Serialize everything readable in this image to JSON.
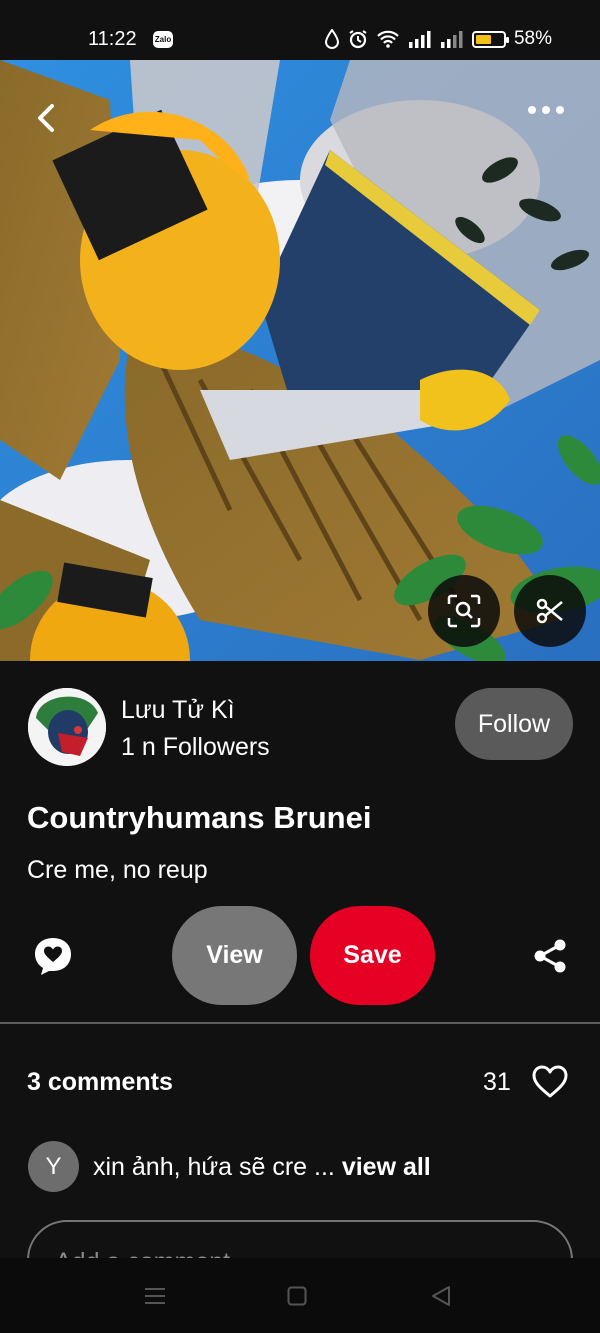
{
  "status_bar": {
    "time": "11:22",
    "notification_app": "Zalo",
    "battery_percent": "58%",
    "battery_level": 0.58,
    "icons": [
      "water-drop-icon",
      "alarm-icon",
      "wifi-icon",
      "signal-icon",
      "signal-icon",
      "battery-icon"
    ]
  },
  "hero": {
    "description_icons": [
      "back-icon",
      "more-icon",
      "visual-search-icon",
      "scissors-icon"
    ]
  },
  "author": {
    "name": "Lưu Tử Kì",
    "followers": "1 n Followers",
    "follow_label": "Follow"
  },
  "pin": {
    "title": "Countryhumans Brunei",
    "description": "Cre me, no reup"
  },
  "actions": {
    "view_label": "View",
    "save_label": "Save"
  },
  "comments": {
    "count_label": "3 comments",
    "like_count": "31",
    "preview": {
      "avatar_letter": "Y",
      "text": "xin ảnh, hứa sẽ cre ...",
      "view_all_label": "view all"
    },
    "input_placeholder": "Add a comment"
  },
  "colors": {
    "save_button": "#e60023",
    "view_button": "#777777",
    "follow_button": "#5a5a5a",
    "background": "#111111"
  }
}
